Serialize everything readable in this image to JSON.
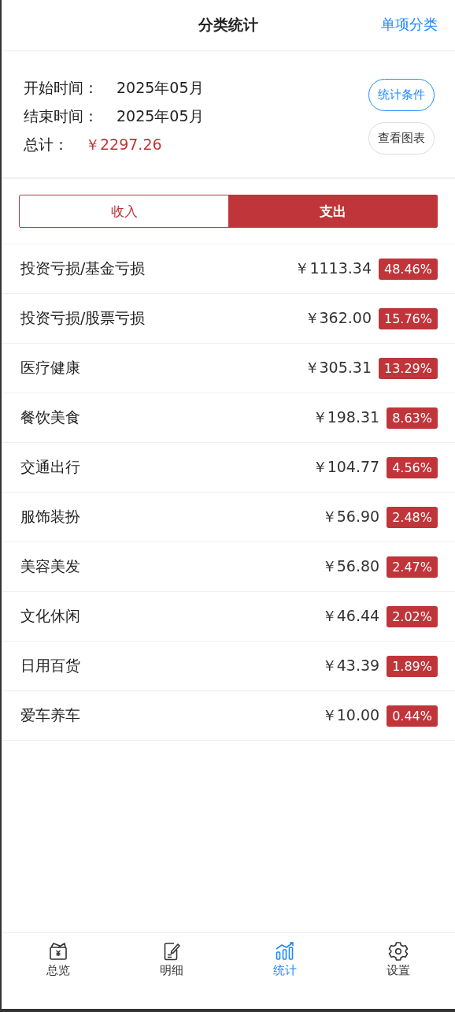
{
  "header": {
    "title": "分类统计",
    "action": "单项分类"
  },
  "summary": {
    "rows": [
      {
        "label": "开始时间：",
        "value": "2025年05月",
        "kind": "plain"
      },
      {
        "label": "结束时间：",
        "value": "2025年05月",
        "kind": "plain"
      },
      {
        "label": "总计：",
        "value": "￥2297.26",
        "kind": "total"
      }
    ],
    "buttons": [
      {
        "label": "统计条件",
        "kind": "primary"
      },
      {
        "label": "查看图表",
        "kind": "default"
      }
    ]
  },
  "segments": [
    {
      "label": "收入",
      "selected": false
    },
    {
      "label": "支出",
      "selected": true
    }
  ],
  "categories": [
    {
      "name": "投资亏损/基金亏损",
      "amount": "￥1113.34",
      "percent": "48.46%"
    },
    {
      "name": "投资亏损/股票亏损",
      "amount": "￥362.00",
      "percent": "15.76%"
    },
    {
      "name": "医疗健康",
      "amount": "￥305.31",
      "percent": "13.29%"
    },
    {
      "name": "餐饮美食",
      "amount": "￥198.31",
      "percent": "8.63%"
    },
    {
      "name": "交通出行",
      "amount": "￥104.77",
      "percent": "4.56%"
    },
    {
      "name": "服饰装扮",
      "amount": "￥56.90",
      "percent": "2.48%"
    },
    {
      "name": "美容美发",
      "amount": "￥56.80",
      "percent": "2.47%"
    },
    {
      "name": "文化休闲",
      "amount": "￥46.44",
      "percent": "2.02%"
    },
    {
      "name": "日用百货",
      "amount": "￥43.39",
      "percent": "1.89%"
    },
    {
      "name": "爱车养车",
      "amount": "￥10.00",
      "percent": "0.44%"
    }
  ],
  "tab_bar": [
    {
      "label": "总览",
      "kind": "wallet",
      "selected": false
    },
    {
      "label": "明细",
      "kind": "note",
      "selected": false
    },
    {
      "label": "统计",
      "kind": "chart",
      "selected": true
    },
    {
      "label": "设置",
      "kind": "gear",
      "selected": false
    }
  ]
}
